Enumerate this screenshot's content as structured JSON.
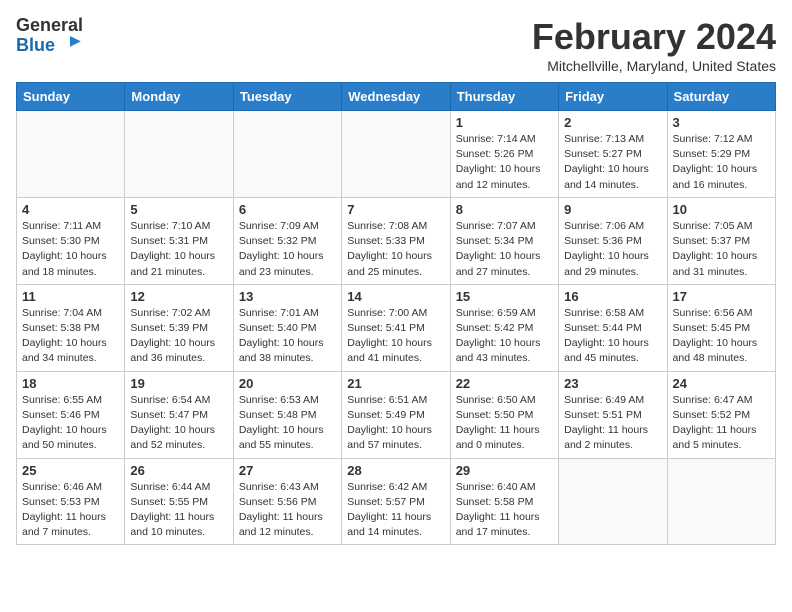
{
  "header": {
    "logo_line1": "General",
    "logo_line2": "Blue",
    "month_title": "February 2024",
    "location": "Mitchellville, Maryland, United States"
  },
  "weekdays": [
    "Sunday",
    "Monday",
    "Tuesday",
    "Wednesday",
    "Thursday",
    "Friday",
    "Saturday"
  ],
  "weeks": [
    [
      {
        "day": "",
        "info": ""
      },
      {
        "day": "",
        "info": ""
      },
      {
        "day": "",
        "info": ""
      },
      {
        "day": "",
        "info": ""
      },
      {
        "day": "1",
        "info": "Sunrise: 7:14 AM\nSunset: 5:26 PM\nDaylight: 10 hours\nand 12 minutes."
      },
      {
        "day": "2",
        "info": "Sunrise: 7:13 AM\nSunset: 5:27 PM\nDaylight: 10 hours\nand 14 minutes."
      },
      {
        "day": "3",
        "info": "Sunrise: 7:12 AM\nSunset: 5:29 PM\nDaylight: 10 hours\nand 16 minutes."
      }
    ],
    [
      {
        "day": "4",
        "info": "Sunrise: 7:11 AM\nSunset: 5:30 PM\nDaylight: 10 hours\nand 18 minutes."
      },
      {
        "day": "5",
        "info": "Sunrise: 7:10 AM\nSunset: 5:31 PM\nDaylight: 10 hours\nand 21 minutes."
      },
      {
        "day": "6",
        "info": "Sunrise: 7:09 AM\nSunset: 5:32 PM\nDaylight: 10 hours\nand 23 minutes."
      },
      {
        "day": "7",
        "info": "Sunrise: 7:08 AM\nSunset: 5:33 PM\nDaylight: 10 hours\nand 25 minutes."
      },
      {
        "day": "8",
        "info": "Sunrise: 7:07 AM\nSunset: 5:34 PM\nDaylight: 10 hours\nand 27 minutes."
      },
      {
        "day": "9",
        "info": "Sunrise: 7:06 AM\nSunset: 5:36 PM\nDaylight: 10 hours\nand 29 minutes."
      },
      {
        "day": "10",
        "info": "Sunrise: 7:05 AM\nSunset: 5:37 PM\nDaylight: 10 hours\nand 31 minutes."
      }
    ],
    [
      {
        "day": "11",
        "info": "Sunrise: 7:04 AM\nSunset: 5:38 PM\nDaylight: 10 hours\nand 34 minutes."
      },
      {
        "day": "12",
        "info": "Sunrise: 7:02 AM\nSunset: 5:39 PM\nDaylight: 10 hours\nand 36 minutes."
      },
      {
        "day": "13",
        "info": "Sunrise: 7:01 AM\nSunset: 5:40 PM\nDaylight: 10 hours\nand 38 minutes."
      },
      {
        "day": "14",
        "info": "Sunrise: 7:00 AM\nSunset: 5:41 PM\nDaylight: 10 hours\nand 41 minutes."
      },
      {
        "day": "15",
        "info": "Sunrise: 6:59 AM\nSunset: 5:42 PM\nDaylight: 10 hours\nand 43 minutes."
      },
      {
        "day": "16",
        "info": "Sunrise: 6:58 AM\nSunset: 5:44 PM\nDaylight: 10 hours\nand 45 minutes."
      },
      {
        "day": "17",
        "info": "Sunrise: 6:56 AM\nSunset: 5:45 PM\nDaylight: 10 hours\nand 48 minutes."
      }
    ],
    [
      {
        "day": "18",
        "info": "Sunrise: 6:55 AM\nSunset: 5:46 PM\nDaylight: 10 hours\nand 50 minutes."
      },
      {
        "day": "19",
        "info": "Sunrise: 6:54 AM\nSunset: 5:47 PM\nDaylight: 10 hours\nand 52 minutes."
      },
      {
        "day": "20",
        "info": "Sunrise: 6:53 AM\nSunset: 5:48 PM\nDaylight: 10 hours\nand 55 minutes."
      },
      {
        "day": "21",
        "info": "Sunrise: 6:51 AM\nSunset: 5:49 PM\nDaylight: 10 hours\nand 57 minutes."
      },
      {
        "day": "22",
        "info": "Sunrise: 6:50 AM\nSunset: 5:50 PM\nDaylight: 11 hours\nand 0 minutes."
      },
      {
        "day": "23",
        "info": "Sunrise: 6:49 AM\nSunset: 5:51 PM\nDaylight: 11 hours\nand 2 minutes."
      },
      {
        "day": "24",
        "info": "Sunrise: 6:47 AM\nSunset: 5:52 PM\nDaylight: 11 hours\nand 5 minutes."
      }
    ],
    [
      {
        "day": "25",
        "info": "Sunrise: 6:46 AM\nSunset: 5:53 PM\nDaylight: 11 hours\nand 7 minutes."
      },
      {
        "day": "26",
        "info": "Sunrise: 6:44 AM\nSunset: 5:55 PM\nDaylight: 11 hours\nand 10 minutes."
      },
      {
        "day": "27",
        "info": "Sunrise: 6:43 AM\nSunset: 5:56 PM\nDaylight: 11 hours\nand 12 minutes."
      },
      {
        "day": "28",
        "info": "Sunrise: 6:42 AM\nSunset: 5:57 PM\nDaylight: 11 hours\nand 14 minutes."
      },
      {
        "day": "29",
        "info": "Sunrise: 6:40 AM\nSunset: 5:58 PM\nDaylight: 11 hours\nand 17 minutes."
      },
      {
        "day": "",
        "info": ""
      },
      {
        "day": "",
        "info": ""
      }
    ]
  ]
}
